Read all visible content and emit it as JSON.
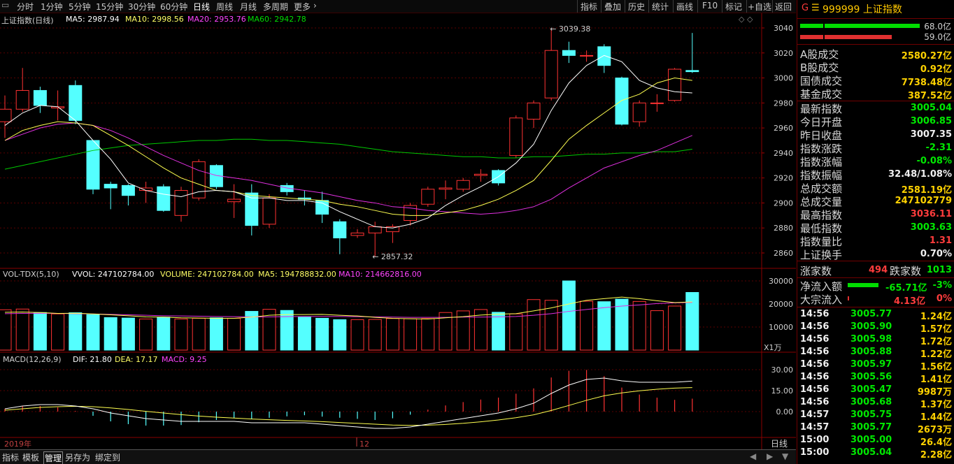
{
  "toolbar": {
    "periods": [
      "分时",
      "1分钟",
      "5分钟",
      "15分钟",
      "30分钟",
      "60分钟",
      "日线",
      "周线",
      "月线",
      "多周期",
      "更多"
    ],
    "active_period": "日线",
    "tools": [
      "指标",
      "叠加",
      "历史",
      "统计",
      "画线",
      "F10",
      "标记",
      "+自选",
      "返回"
    ]
  },
  "chart_header": {
    "title": "上证指数(日线)",
    "ma5": "MA5: 2987.94",
    "ma10": "MA10: 2998.56",
    "ma20": "MA20: 2953.76",
    "ma60": "MA60: 2942.78"
  },
  "vol_header": {
    "name": "VOL-TDX(5,10)",
    "vvol": "VVOL: 247102784.00",
    "volume": "VOLUME: 247102784.00",
    "ma5": "MA5: 194788832.00",
    "ma10": "MA10: 214662816.00"
  },
  "macd_header": {
    "name": "MACD(12,26,9)",
    "dif": "DIF: 21.80",
    "dea": "DEA: 17.17",
    "macd": "MACD: 9.25"
  },
  "annotations": {
    "high": "3039.38",
    "low": "2857.32"
  },
  "axis": {
    "price_ticks": [
      "3040",
      "3020",
      "3000",
      "2980",
      "2960",
      "2940",
      "2920",
      "2900",
      "2880",
      "2860"
    ],
    "vol_ticks": [
      "30000",
      "20000",
      "10000"
    ],
    "vol_unit": "X1万",
    "macd_ticks": [
      "30.00",
      "15.00",
      "0.00"
    ],
    "date_left": "2019年",
    "date_mid": "12",
    "period_label": "日线"
  },
  "chart_data": {
    "type": "candlestick",
    "price_ylim": [
      2850,
      3045
    ],
    "candles": [
      {
        "o": 2965,
        "c": 2975,
        "h": 2986,
        "l": 2952
      },
      {
        "o": 2975,
        "c": 2990,
        "h": 3008,
        "l": 2973
      },
      {
        "o": 2990,
        "c": 2978,
        "h": 2993,
        "l": 2972
      },
      {
        "o": 2976,
        "c": 2977,
        "h": 2990,
        "l": 2966
      },
      {
        "o": 2994,
        "c": 2966,
        "h": 2998,
        "l": 2963
      },
      {
        "o": 2950,
        "c": 2911,
        "h": 2950,
        "l": 2907
      },
      {
        "o": 2915,
        "c": 2912,
        "h": 2917,
        "l": 2895
      },
      {
        "o": 2914,
        "c": 2906,
        "h": 2915,
        "l": 2898
      },
      {
        "o": 2910,
        "c": 2912,
        "h": 2917,
        "l": 2900
      },
      {
        "o": 2913,
        "c": 2894,
        "h": 2915,
        "l": 2893
      },
      {
        "o": 2890,
        "c": 2910,
        "h": 2913,
        "l": 2885
      },
      {
        "o": 2904,
        "c": 2933,
        "h": 2935,
        "l": 2902
      },
      {
        "o": 2930,
        "c": 2913,
        "h": 2931,
        "l": 2911
      },
      {
        "o": 2901,
        "c": 2903,
        "h": 2915,
        "l": 2888
      },
      {
        "o": 2908,
        "c": 2882,
        "h": 2915,
        "l": 2874
      },
      {
        "o": 2883,
        "c": 2904,
        "h": 2907,
        "l": 2880
      },
      {
        "o": 2914,
        "c": 2909,
        "h": 2916,
        "l": 2906
      },
      {
        "o": 2904,
        "c": 2903,
        "h": 2910,
        "l": 2898
      },
      {
        "o": 2902,
        "c": 2891,
        "h": 2909,
        "l": 2884
      },
      {
        "o": 2885,
        "c": 2872,
        "h": 2887,
        "l": 2859
      },
      {
        "o": 2874,
        "c": 2876,
        "h": 2879,
        "l": 2872
      },
      {
        "o": 2876,
        "c": 2881,
        "h": 2885,
        "l": 2857.32
      },
      {
        "o": 2877,
        "c": 2881,
        "h": 2883,
        "l": 2868
      },
      {
        "o": 2886,
        "c": 2898,
        "h": 2900,
        "l": 2882
      },
      {
        "o": 2899,
        "c": 2911,
        "h": 2913,
        "l": 2897
      },
      {
        "o": 2911,
        "c": 2912,
        "h": 2918,
        "l": 2903
      },
      {
        "o": 2911,
        "c": 2918,
        "h": 2920,
        "l": 2909
      },
      {
        "o": 2922,
        "c": 2923,
        "h": 2927,
        "l": 2917
      },
      {
        "o": 2926,
        "c": 2916,
        "h": 2927,
        "l": 2914
      },
      {
        "o": 2938,
        "c": 2968,
        "h": 2970,
        "l": 2936
      },
      {
        "o": 2967,
        "c": 2980,
        "h": 2982,
        "l": 2960
      },
      {
        "o": 2984,
        "c": 3022,
        "h": 3039.38,
        "l": 2982
      },
      {
        "o": 3022,
        "c": 3018,
        "h": 3029,
        "l": 3012
      },
      {
        "o": 3018,
        "c": 3018,
        "h": 3022,
        "l": 3013
      },
      {
        "o": 3025,
        "c": 3010,
        "h": 3027,
        "l": 3004
      },
      {
        "o": 3000,
        "c": 2963,
        "h": 3001,
        "l": 2962
      },
      {
        "o": 2965,
        "c": 2980,
        "h": 2982,
        "l": 2961
      },
      {
        "o": 2980,
        "c": 2980,
        "h": 2987,
        "l": 2973
      },
      {
        "o": 2982,
        "c": 3007,
        "h": 3008,
        "l": 2981
      },
      {
        "o": 3006,
        "c": 3005,
        "h": 3036,
        "l": 3004
      }
    ],
    "ma5": [
      2962,
      2972,
      2978,
      2977,
      2966,
      2950,
      2935,
      2916,
      2910,
      2907,
      2905,
      2909,
      2910,
      2909,
      2904,
      2904,
      2902,
      2902,
      2900,
      2893,
      2887,
      2881,
      2880,
      2883,
      2888,
      2898,
      2906,
      2913,
      2921,
      2932,
      2947,
      2974,
      2996,
      3010,
      3018,
      3013,
      2998,
      2992,
      2989,
      2988
    ],
    "ma10": [
      2950,
      2958,
      2962,
      2965,
      2964,
      2962,
      2954,
      2946,
      2937,
      2928,
      2920,
      2915,
      2910,
      2909,
      2906,
      2905,
      2904,
      2903,
      2902,
      2899,
      2897,
      2894,
      2891,
      2890,
      2890,
      2892,
      2894,
      2898,
      2903,
      2910,
      2918,
      2934,
      2951,
      2962,
      2972,
      2982,
      2987,
      2996,
      3000,
      2998
    ],
    "ma20": [
      2950,
      2955,
      2960,
      2963,
      2964,
      2962,
      2958,
      2952,
      2945,
      2938,
      2932,
      2926,
      2922,
      2920,
      2918,
      2915,
      2912,
      2910,
      2908,
      2905,
      2902,
      2900,
      2897,
      2896,
      2894,
      2893,
      2892,
      2891,
      2892,
      2894,
      2897,
      2903,
      2912,
      2920,
      2928,
      2933,
      2938,
      2942,
      2948,
      2954
    ],
    "ma60": [
      2927,
      2930,
      2933,
      2936,
      2939,
      2942,
      2944,
      2946,
      2947,
      2948,
      2949,
      2950,
      2950,
      2951,
      2951,
      2950,
      2950,
      2949,
      2948,
      2947,
      2945,
      2943,
      2941,
      2940,
      2939,
      2938,
      2937,
      2937,
      2936,
      2936,
      2937,
      2937,
      2938,
      2939,
      2939,
      2940,
      2940,
      2941,
      2941,
      2943
    ],
    "vol_ylim": [
      0,
      33000
    ],
    "volume": [
      17500,
      17800,
      16300,
      15700,
      16200,
      15400,
      14100,
      13900,
      13500,
      14300,
      13500,
      13800,
      14000,
      13800,
      16800,
      17700,
      17200,
      14300,
      13800,
      13200,
      13200,
      13300,
      13700,
      13600,
      13700,
      16300,
      17000,
      17600,
      16400,
      15700,
      21900,
      21600,
      30000,
      21200,
      21000,
      22100,
      21100,
      17100,
      19100,
      25000
    ],
    "vol_ma5": [
      16400,
      16500,
      16300,
      15900,
      16000,
      15700,
      15300,
      14900,
      14400,
      14300,
      14000,
      13900,
      13800,
      13800,
      14300,
      15100,
      15400,
      15400,
      15500,
      15100,
      14800,
      14200,
      13800,
      13600,
      13500,
      14000,
      14500,
      15200,
      15600,
      15800,
      17000,
      18300,
      20000,
      21600,
      22300,
      23000,
      22300,
      21400,
      20600,
      20900
    ],
    "vol_ma10": [
      15800,
      15900,
      16000,
      15900,
      15800,
      15700,
      15500,
      15300,
      15100,
      14900,
      14800,
      14700,
      14600,
      14500,
      14400,
      14400,
      14500,
      14600,
      14600,
      14600,
      14500,
      14400,
      14300,
      14200,
      14200,
      14200,
      14300,
      14300,
      14400,
      14600,
      15100,
      15800,
      16800,
      17600,
      18400,
      19100,
      19600,
      20200,
      20500,
      20700
    ],
    "macd_ylim": [
      -20,
      40
    ],
    "dif": [
      2,
      4,
      5,
      5,
      4,
      2,
      -1,
      -3,
      -5,
      -6,
      -7,
      -7,
      -7,
      -7,
      -8,
      -8,
      -8,
      -8,
      -9,
      -10,
      -11,
      -12,
      -12,
      -11,
      -9,
      -7,
      -5,
      -3,
      -1,
      2,
      6,
      13,
      19,
      23,
      24,
      22,
      21,
      21,
      21,
      21.8
    ],
    "dea": [
      1,
      2,
      3,
      3.5,
      3.8,
      3.5,
      2.6,
      1.5,
      0.2,
      -1,
      -2.2,
      -3.2,
      -4,
      -4.6,
      -5.3,
      -5.8,
      -6.3,
      -6.7,
      -7.2,
      -7.8,
      -8.4,
      -9,
      -9.6,
      -9.9,
      -9.7,
      -9.2,
      -8.4,
      -7.3,
      -6,
      -4.4,
      -2.3,
      0.8,
      4.4,
      8.1,
      11.3,
      13.4,
      14.9,
      16,
      16.8,
      17.17
    ],
    "macd": [
      2,
      4,
      4,
      3,
      0.5,
      -3,
      -7,
      -9,
      -10,
      -10,
      -9.6,
      -7.6,
      -6,
      -4.8,
      -5.4,
      -4.4,
      -3.4,
      -2.6,
      -3.6,
      -4.4,
      -5.2,
      -6,
      -4.8,
      -2.2,
      1.4,
      4.4,
      6.8,
      8.6,
      10,
      12.8,
      16.6,
      24.4,
      29.2,
      29.8,
      25.4,
      17.2,
      12.2,
      10,
      8.4,
      9.25
    ]
  },
  "quote": {
    "marker": "G",
    "code_name": "999999 上证指数",
    "bar1_value": "68.0亿",
    "bar2_value": "59.0亿",
    "stats": [
      {
        "label": "A股成交",
        "value": "2580.27亿",
        "color": "yel"
      },
      {
        "label": "B股成交",
        "value": "0.92亿",
        "color": "yel"
      },
      {
        "label": "国债成交",
        "value": "7738.48亿",
        "color": "yel"
      },
      {
        "label": "基金成交",
        "value": "387.52亿",
        "color": "yel"
      },
      {
        "label": "最新指数",
        "value": "3005.04",
        "color": "grn"
      },
      {
        "label": "今日开盘",
        "value": "3006.85",
        "color": "grn"
      },
      {
        "label": "昨日收盘",
        "value": "3007.35",
        "color": "wht"
      },
      {
        "label": "指数涨跌",
        "value": "-2.31",
        "color": "grn"
      },
      {
        "label": "指数涨幅",
        "value": "-0.08%",
        "color": "grn"
      },
      {
        "label": "指数振幅",
        "value": "32.48/1.08%",
        "color": "wht"
      },
      {
        "label": "总成交额",
        "value": "2581.19亿",
        "color": "yel"
      },
      {
        "label": "总成交量",
        "value": "247102779",
        "color": "yel"
      },
      {
        "label": "最高指数",
        "value": "3036.11",
        "color": "red"
      },
      {
        "label": "最低指数",
        "value": "3003.63",
        "color": "grn"
      },
      {
        "label": "指数量比",
        "value": "1.31",
        "color": "red"
      },
      {
        "label": "上证换手",
        "value": "0.70%",
        "color": "wht"
      }
    ],
    "up_label": "涨家数",
    "up_count": "494",
    "down_label": "跌家数",
    "down_count": "1013",
    "inflow_label": "净流入额",
    "inflow_value": "-65.71亿",
    "inflow_pct": "-3%",
    "block_label": "大宗流入",
    "block_value": "4.13亿",
    "block_pct": "0%"
  },
  "ticks": [
    {
      "time": "14:56",
      "price": "3005.77",
      "vol": "1.24亿"
    },
    {
      "time": "14:56",
      "price": "3005.90",
      "vol": "1.57亿"
    },
    {
      "time": "14:56",
      "price": "3005.98",
      "vol": "1.72亿"
    },
    {
      "time": "14:56",
      "price": "3005.88",
      "vol": "1.22亿"
    },
    {
      "time": "14:56",
      "price": "3005.97",
      "vol": "1.56亿"
    },
    {
      "time": "14:56",
      "price": "3005.56",
      "vol": "1.41亿"
    },
    {
      "time": "14:56",
      "price": "3005.47",
      "vol": "9987万"
    },
    {
      "time": "14:56",
      "price": "3005.68",
      "vol": "1.37亿"
    },
    {
      "time": "14:57",
      "price": "3005.75",
      "vol": "1.44亿"
    },
    {
      "time": "14:57",
      "price": "3005.77",
      "vol": "2673万"
    },
    {
      "time": "15:00",
      "price": "3005.00",
      "vol": "26.4亿"
    },
    {
      "time": "15:00",
      "price": "3005.04",
      "vol": "2.28亿"
    }
  ],
  "bottom_tabs": [
    "指标",
    "模板",
    "管理",
    "另存为",
    "绑定到"
  ],
  "bottom_active": "管理"
}
